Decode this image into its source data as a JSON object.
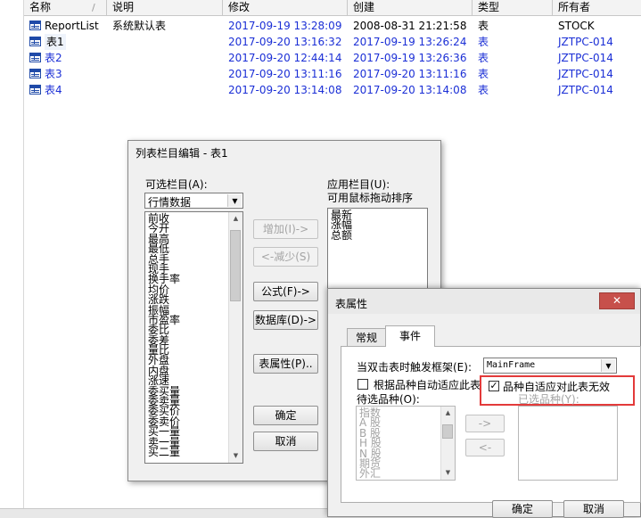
{
  "list": {
    "columns": [
      {
        "label": "名称"
      },
      {
        "label": "说明"
      },
      {
        "label": "修改"
      },
      {
        "label": "创建"
      },
      {
        "label": "类型"
      },
      {
        "label": "所有者"
      }
    ],
    "sort_glyph": "/",
    "rows": [
      {
        "name": "ReportList",
        "desc": "系统默认表",
        "modified": "2017-09-19 13:28:09",
        "created": "2008-08-31 21:21:58",
        "type": "表",
        "owner": "STOCK"
      },
      {
        "name": "表1",
        "desc": "",
        "modified": "2017-09-20 13:16:32",
        "created": "2017-09-19 13:26:24",
        "type": "表",
        "owner": "JZTPC-014"
      },
      {
        "name": "表2",
        "desc": "",
        "modified": "2017-09-20 12:44:14",
        "created": "2017-09-19 13:26:36",
        "type": "表",
        "owner": "JZTPC-014"
      },
      {
        "name": "表3",
        "desc": "",
        "modified": "2017-09-20 13:11:16",
        "created": "2017-09-20 13:11:16",
        "type": "表",
        "owner": "JZTPC-014"
      },
      {
        "name": "表4",
        "desc": "",
        "modified": "2017-09-20 13:14:08",
        "created": "2017-09-20 13:14:08",
        "type": "表",
        "owner": "JZTPC-014"
      }
    ]
  },
  "column_editor": {
    "title": "列表栏目编辑 - 表1",
    "available_label": "可选栏目(A):",
    "available_combo_value": "行情数据",
    "available_items": [
      "前收",
      "今开",
      "最高",
      "最低",
      "总手",
      "现手",
      "换手率",
      "均价",
      "涨跌",
      "振幅",
      "市盈率",
      "委比",
      "委差",
      "量比",
      "外盘",
      "内盘",
      "涨速",
      "委买量",
      "委卖量",
      "委买价",
      "委卖价",
      "买一量",
      "卖一量",
      "买二量"
    ],
    "applied_label": "应用栏目(U):",
    "applied_hint": "可用鼠标拖动排序",
    "applied_items": [
      "最新",
      "涨幅",
      "总额"
    ],
    "btn_add": "增加(I)->",
    "btn_remove": "<-减少(S)",
    "btn_formula": "公式(F)->",
    "btn_database": "数据库(D)->",
    "btn_table_props": "表属性(P)..",
    "btn_ok": "确定",
    "btn_cancel": "取消"
  },
  "table_props": {
    "title": "表属性",
    "close_glyph": "✕",
    "tabs": [
      "常规",
      "事件"
    ],
    "active_tab": "事件",
    "frame_label": "当双击表时触发框架(E):",
    "frame_value": "MainFrame",
    "auto_fit_label": "根据品种自动适应此表",
    "auto_fit_checked": false,
    "invalid_label": "品种自适应对此表无效",
    "invalid_checked": true,
    "candidates_label": "待选品种(O):",
    "candidates": [
      "指数",
      "A 股",
      "B 股",
      "H 股",
      "N 股",
      "期货",
      "外汇"
    ],
    "selected_label": "已选品种(Y):",
    "move_right": "->",
    "move_left": "<-",
    "btn_ok": "确定",
    "btn_cancel": "取消",
    "highlight_color": "#e33a3a"
  }
}
